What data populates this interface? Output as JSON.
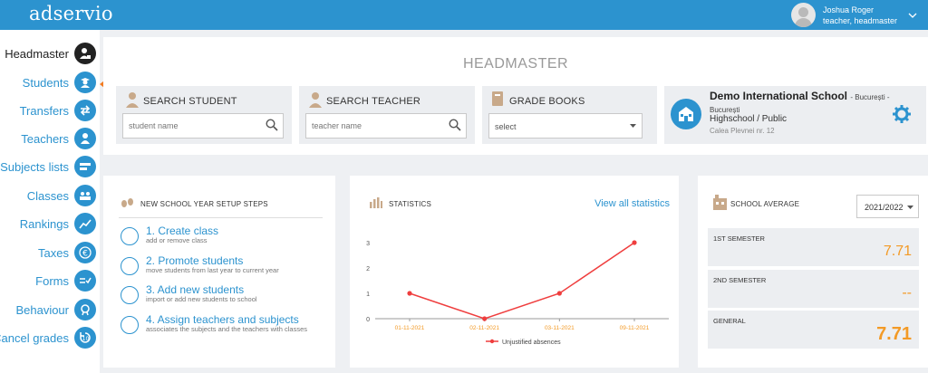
{
  "app": {
    "logo": "adservio"
  },
  "user": {
    "name": "Joshua Roger",
    "role": "teacher, headmaster"
  },
  "sidebar": {
    "items": [
      {
        "label": "Headmaster",
        "icon": "headmaster-icon",
        "active": true
      },
      {
        "label": "Students",
        "icon": "students-icon"
      },
      {
        "label": "Transfers",
        "icon": "transfers-icon"
      },
      {
        "label": "Teachers",
        "icon": "teachers-icon"
      },
      {
        "label": "Subjects lists",
        "icon": "subjects-icon"
      },
      {
        "label": "Classes",
        "icon": "classes-icon"
      },
      {
        "label": "Rankings",
        "icon": "rankings-icon"
      },
      {
        "label": "Taxes",
        "icon": "taxes-icon"
      },
      {
        "label": "Forms",
        "icon": "forms-icon"
      },
      {
        "label": "Behaviour",
        "icon": "behaviour-icon"
      },
      {
        "label": "Cancel grades",
        "icon": "cancel-grades-icon"
      }
    ]
  },
  "header": {
    "title": "HEADMASTER",
    "search_student": {
      "title": "SEARCH STUDENT",
      "placeholder": "student name"
    },
    "search_teacher": {
      "title": "SEARCH TEACHER",
      "placeholder": "teacher name"
    },
    "grade_books": {
      "title": "GRADE BOOKS",
      "selected": "select"
    }
  },
  "school": {
    "name": "Demo International School",
    "location": "- București - București",
    "type": "Highschool / Public",
    "address": "Calea Plevnei nr. 12"
  },
  "setup": {
    "title": "NEW SCHOOL YEAR SETUP STEPS",
    "steps": [
      {
        "title": "1. Create class",
        "desc": "add or remove class"
      },
      {
        "title": "2. Promote students",
        "desc": "move students from last year to current year"
      },
      {
        "title": "3. Add new students",
        "desc": "import or add new students to school"
      },
      {
        "title": "4. Assign teachers and subjects",
        "desc": "associates the subjects and the teachers with classes"
      }
    ]
  },
  "statistics": {
    "title": "STATISTICS",
    "link": "View all statistics"
  },
  "chart_data": {
    "type": "line",
    "x": [
      "01-11-2021",
      "02-11-2021",
      "03-11-2021",
      "09-11-2021"
    ],
    "series": [
      {
        "name": "Unjustified absences",
        "values": [
          1,
          0,
          1,
          3
        ],
        "color": "#ef3e3e"
      }
    ],
    "ylim": [
      0,
      3
    ],
    "yticks": [
      "0",
      "1",
      "2",
      "3"
    ],
    "legend": "bottom"
  },
  "average": {
    "title": "SCHOOL AVERAGE",
    "year": "2021/2022",
    "rows": [
      {
        "label": "1ST SEMESTER",
        "value": "7.71"
      },
      {
        "label": "2ND SEMESTER",
        "value": "--"
      },
      {
        "label": "GENERAL",
        "value": "7.71"
      }
    ]
  },
  "colors": {
    "accent": "#2c93cf",
    "orange": "#f39a26",
    "arrow": "#f27b21"
  }
}
